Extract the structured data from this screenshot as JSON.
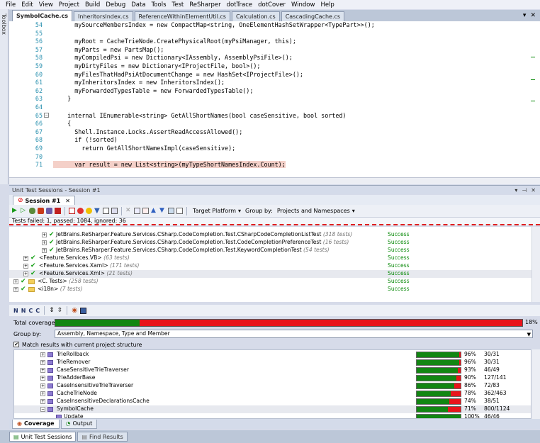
{
  "menu": [
    "File",
    "Edit",
    "View",
    "Project",
    "Build",
    "Debug",
    "Data",
    "Tools",
    "Test",
    "ReSharper",
    "dotTrace",
    "dotCover",
    "Window",
    "Help"
  ],
  "toolbox_label": "Toolbox",
  "doc_tabs": [
    "SymbolCache.cs",
    "InheritorsIndex.cs",
    "ReferenceWithinElementUtil.cs",
    "Calculation.cs",
    "CascadingCache.cs"
  ],
  "code_lines": [
    {
      "n": "54",
      "t": "      mySourceMembersIndex = new CompactMap<string, OneElementHashSetWrapper<TypePart>>();"
    },
    {
      "n": "55",
      "t": ""
    },
    {
      "n": "56",
      "t": "      myRoot = CacheTrieNode.CreatePhysicalRoot(myPsiManager, this);"
    },
    {
      "n": "57",
      "t": "      myParts = new PartsMap();"
    },
    {
      "n": "58",
      "t": "      myCompiledPsi = new Dictionary<IAssembly, AssemblyPsiFile>();"
    },
    {
      "n": "59",
      "t": "      myDirtyFiles = new Dictionary<IProjectFile, bool>();"
    },
    {
      "n": "60",
      "t": "      myFilesThatHadPsiAtDocumentChange = new HashSet<IProjectFile>();"
    },
    {
      "n": "61",
      "t": "      myInheritorsIndex = new InheritorsIndex();"
    },
    {
      "n": "62",
      "t": "      myForwardedTypesTable = new ForwardedTypesTable();"
    },
    {
      "n": "63",
      "t": "    }"
    },
    {
      "n": "64",
      "t": ""
    },
    {
      "n": "65",
      "t": "    internal IEnumerable<string> GetAllShortNames(bool caseSensitive, bool sorted)"
    },
    {
      "n": "66",
      "t": "    {"
    },
    {
      "n": "67",
      "t": "      Shell.Instance.Locks.AssertReadAccessAllowed();"
    },
    {
      "n": "68",
      "t": "      if (!sorted)"
    },
    {
      "n": "69",
      "t": "        return GetAllShortNamesImpl(caseSensitive);"
    },
    {
      "n": "70",
      "t": ""
    },
    {
      "n": "71",
      "t": "      var result = new List<string>(myTypeShortNamesIndex.Count);"
    }
  ],
  "tool_window_title": "Unit Test Sessions - Session #1",
  "session_tab": "Session #1",
  "toolbar": {
    "target_platform": "Target Platform",
    "group_by_label": "Group by:",
    "group_by_value": "Projects and Namespaces"
  },
  "status_text": "Tests failed: 1, passed: 1084, ignored: 36",
  "test_rows": [
    {
      "label": "JetBrains.ReSharper.Feature.Services.CSharp.CodeCompletion.Test.CSharpCodeCompletionListTest",
      "count": "(318 tests)",
      "result": "Success",
      "indent": 46
    },
    {
      "label": "JetBrains.ReSharper.Feature.Services.CSharp.CodeCompletion.Test.CodeCompletionPreferenceTest",
      "count": "(16 tests)",
      "result": "Success",
      "indent": 46
    },
    {
      "label": "JetBrains.ReSharper.Feature.Services.CSharp.CodeCompletion.Test.KeywordCompletionTest",
      "count": "(54 tests)",
      "result": "Success",
      "indent": 46
    },
    {
      "label": "<Feature.Services.VB>",
      "count": "(63 tests)",
      "result": "Success",
      "indent": 20
    },
    {
      "label": "<Feature.Services.Xaml>",
      "count": "(171 tests)",
      "result": "Success",
      "indent": 20
    },
    {
      "label": "<Feature.Services.Xml>",
      "count": "(21 tests)",
      "result": "Success",
      "indent": 20
    },
    {
      "label": "<C. Tests>",
      "count": "(258 tests)",
      "result": "Success",
      "indent": 8
    },
    {
      "label": "<i18n>",
      "count": "(7 tests)",
      "result": "Success",
      "indent": 8
    }
  ],
  "coverage": {
    "total_label": "Total coverage:",
    "total_pct": "18%",
    "total_value": 18,
    "group_by_label": "Group by:",
    "group_by_value": "Assembly, Namespace, Type and Member",
    "match_label": "Match results with current project structure",
    "rows": [
      {
        "name": "TrieRollback",
        "pct": "96%",
        "frac": "30/31",
        "v": 96
      },
      {
        "name": "TrieRemover",
        "pct": "96%",
        "frac": "30/31",
        "v": 96
      },
      {
        "name": "CaseSensitiveTrieTraverser",
        "pct": "93%",
        "frac": "46/49",
        "v": 93
      },
      {
        "name": "TrieAdderBase",
        "pct": "90%",
        "frac": "127/141",
        "v": 90
      },
      {
        "name": "CaseInsensitiveTrieTraverser",
        "pct": "86%",
        "frac": "72/83",
        "v": 86
      },
      {
        "name": "CacheTrieNode",
        "pct": "78%",
        "frac": "362/463",
        "v": 78
      },
      {
        "name": "CaseInsensitiveDeclarationsCache",
        "pct": "74%",
        "frac": "38/51",
        "v": 74
      },
      {
        "name": "SymbolCache",
        "pct": "71%",
        "frac": "800/1124",
        "v": 71
      },
      {
        "name": "Update",
        "pct": "100%",
        "frac": "46/46",
        "v": 100
      }
    ]
  },
  "bottom_tabs": [
    "Coverage",
    "Output"
  ],
  "window_tabs": [
    "Unit Test Sessions",
    "Find Results"
  ]
}
